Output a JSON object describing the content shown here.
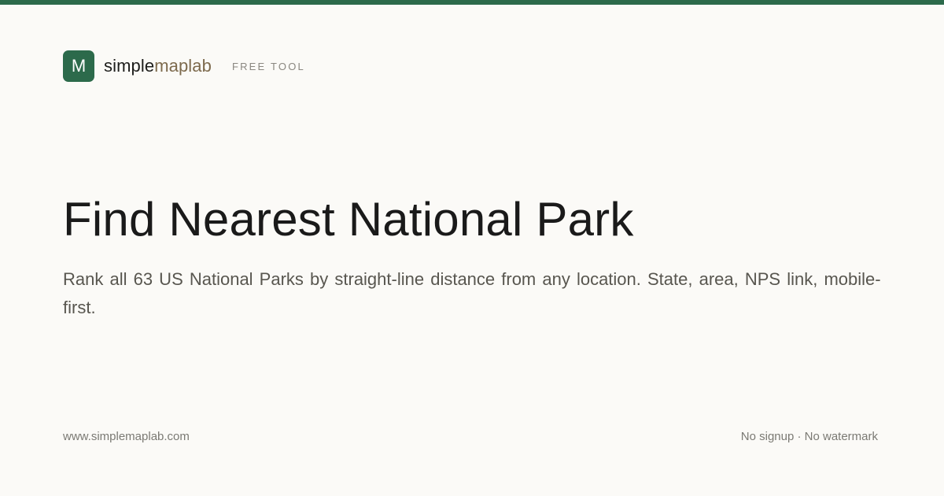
{
  "colors": {
    "accent": "#2c6a4b",
    "background": "#fbfaf7",
    "brand_secondary": "#7d6a4d"
  },
  "brand": {
    "logo_letter": "M",
    "name_part1": "simple",
    "name_part2": "maplab",
    "tag": "FREE TOOL"
  },
  "hero": {
    "title": "Find Nearest National Park",
    "description": "Rank all 63 US National Parks by straight-line distance from any location. State, area, NPS link, mobile-first."
  },
  "footer": {
    "url": "www.simplemaplab.com",
    "features": "No signup · No watermark"
  }
}
